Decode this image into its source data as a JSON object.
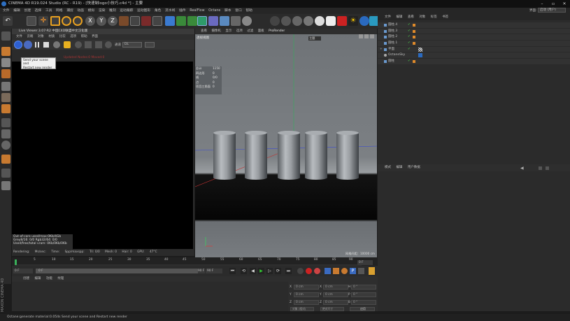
{
  "window": {
    "title": "CINEMA 4D R19.024 Studio (RC - R19) - [快速制logo小技巧.c4d *] - 主要",
    "min": "–",
    "max": "▫",
    "close": "✕"
  },
  "menubar": [
    "文件",
    "编辑",
    "创建",
    "选择",
    "工具",
    "网格",
    "捕捉",
    "动画",
    "模拟",
    "渲染",
    "雕刻",
    "运动跟踪",
    "运动图形",
    "角色",
    "流水线",
    "插件",
    "RealFlow",
    "Octane",
    "脚本",
    "窗口",
    "帮助"
  ],
  "layout": {
    "label": "界面:",
    "value": "启动 (用户)"
  },
  "liveviewer": {
    "title": "Live Viewer 3.07-R2 中国C4D联盟中文汉化版",
    "menu": [
      "文件",
      "云端",
      "对象",
      "材质",
      "比较",
      "选项",
      "帮助",
      "界面"
    ],
    "channel": "通道",
    "channel_value": "DL",
    "status": "Updated Nodes:0 Moved:0",
    "tooltip": [
      "Send your scene and",
      "Restart new render"
    ],
    "info": [
      "Out-of-core used/max:0Kb/4Gb",
      "Grey8/16: 0/0",
      "Rgb32/64: 0/0",
      "Used/free/total vram: 0Kb/0Kb/0Kb"
    ],
    "footer": [
      "Rendering:",
      "Ms/sec:",
      "Time:",
      "Spp/maxspp:",
      "Tri: 0/0",
      "Mesh: 0",
      "Hair: 0",
      "GPU:",
      "47°C"
    ]
  },
  "viewport": {
    "menu": [
      "查看",
      "摄像机",
      "显示",
      "选项",
      "过滤",
      "面板",
      "ProRender"
    ],
    "label": "透视视图",
    "stats": [
      [
        "总计",
        "1150"
      ],
      [
        "四边形",
        "0"
      ],
      [
        "线",
        "0/0"
      ],
      [
        "点",
        "0"
      ],
      [
        "项目三角面",
        "0"
      ]
    ],
    "grid": "网格间距：10000 cm",
    "overlay": "主题"
  },
  "objects": {
    "tabs": [
      "文件",
      "编辑",
      "查看",
      "对象",
      "标签",
      "书签"
    ],
    "rows": [
      {
        "name": "圆柱.4"
      },
      {
        "name": "圆柱.3"
      },
      {
        "name": "圆柱.2"
      },
      {
        "name": "圆柱.1"
      },
      {
        "name": "平面"
      },
      {
        "name": "OctaneSky"
      },
      {
        "name": "圆柱"
      }
    ]
  },
  "attributes": {
    "tabs": [
      "模式",
      "编辑",
      "用户数据"
    ]
  },
  "timeline": {
    "ticks": [
      "0",
      "5",
      "10",
      "15",
      "20",
      "25",
      "30",
      "35",
      "40",
      "45",
      "50",
      "55",
      "60",
      "65",
      "70",
      "75",
      "80",
      "85",
      "90"
    ],
    "frame": "0 F"
  },
  "transport": {
    "start": "0 F",
    "cur": "0 F",
    "end": "90 F",
    "end2": "90 F"
  },
  "material": {
    "menu": [
      "创建",
      "编辑",
      "功能",
      "纹理"
    ]
  },
  "coords": {
    "rows": [
      [
        "X",
        "0 cm",
        "X",
        "0 cm",
        "H",
        "0 °"
      ],
      [
        "Y",
        "0 cm",
        "Y",
        "0 cm",
        "P",
        "0 °"
      ],
      [
        "Z",
        "0 cm",
        "Z",
        "0 cm",
        "B",
        "0 °"
      ]
    ],
    "modes": [
      "对象 (相对)",
      "绝对尺寸"
    ],
    "apply": "应用"
  },
  "statusbar": "Octane:generate material:0.054s     Send your scene and Restart new render",
  "brand": "MAXON CINEMA 4D"
}
